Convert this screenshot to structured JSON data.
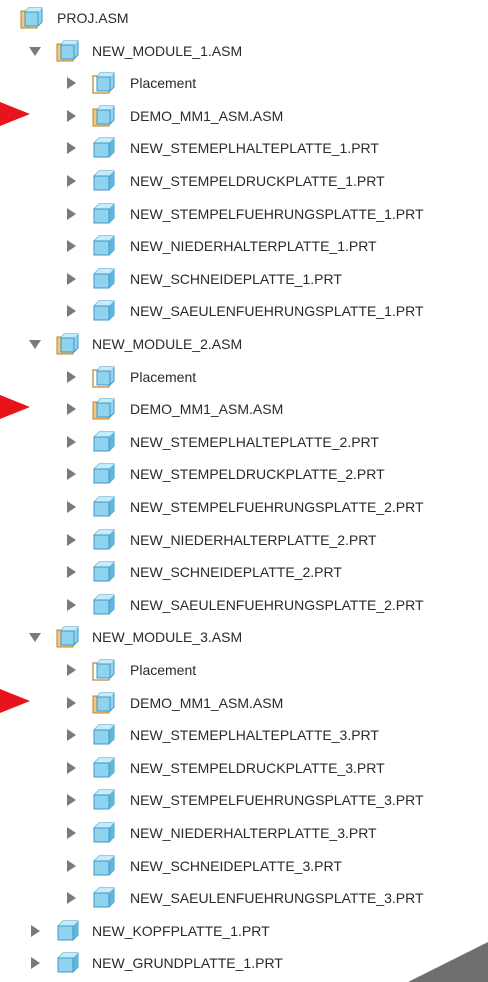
{
  "tree": {
    "root": {
      "label": "PROJ.ASM",
      "icon": "assembly-icon"
    },
    "modules": [
      {
        "label": "NEW_MODULE_1.ASM",
        "icon": "assembly-icon",
        "expanded": true,
        "children": [
          {
            "label": "Placement",
            "icon": "placement-icon"
          },
          {
            "label": "DEMO_MM1_ASM.ASM",
            "icon": "assembly-icon",
            "marked": true
          },
          {
            "label": "NEW_STEMEPLHALTEPLATTE_1.PRT",
            "icon": "part-icon"
          },
          {
            "label": "NEW_STEMPELDRUCKPLATTE_1.PRT",
            "icon": "part-icon"
          },
          {
            "label": "NEW_STEMPELFUEHRUNGSPLATTE_1.PRT",
            "icon": "part-icon"
          },
          {
            "label": "NEW_NIEDERHALTERPLATTE_1.PRT",
            "icon": "part-icon"
          },
          {
            "label": "NEW_SCHNEIDEPLATTE_1.PRT",
            "icon": "part-icon"
          },
          {
            "label": "NEW_SAEULENFUEHRUNGSPLATTE_1.PRT",
            "icon": "part-icon"
          }
        ]
      },
      {
        "label": "NEW_MODULE_2.ASM",
        "icon": "assembly-icon",
        "expanded": true,
        "children": [
          {
            "label": "Placement",
            "icon": "placement-icon"
          },
          {
            "label": "DEMO_MM1_ASM.ASM",
            "icon": "assembly-icon",
            "marked": true
          },
          {
            "label": "NEW_STEMEPLHALTEPLATTE_2.PRT",
            "icon": "part-icon"
          },
          {
            "label": "NEW_STEMPELDRUCKPLATTE_2.PRT",
            "icon": "part-icon"
          },
          {
            "label": "NEW_STEMPELFUEHRUNGSPLATTE_2.PRT",
            "icon": "part-icon"
          },
          {
            "label": "NEW_NIEDERHALTERPLATTE_2.PRT",
            "icon": "part-icon"
          },
          {
            "label": "NEW_SCHNEIDEPLATTE_2.PRT",
            "icon": "part-icon"
          },
          {
            "label": "NEW_SAEULENFUEHRUNGSPLATTE_2.PRT",
            "icon": "part-icon"
          }
        ]
      },
      {
        "label": "NEW_MODULE_3.ASM",
        "icon": "assembly-icon",
        "expanded": true,
        "children": [
          {
            "label": "Placement",
            "icon": "placement-icon"
          },
          {
            "label": "DEMO_MM1_ASM.ASM",
            "icon": "assembly-icon",
            "marked": true
          },
          {
            "label": "NEW_STEMEPLHALTEPLATTE_3.PRT",
            "icon": "part-icon"
          },
          {
            "label": "NEW_STEMPELDRUCKPLATTE_3.PRT",
            "icon": "part-icon"
          },
          {
            "label": "NEW_STEMPELFUEHRUNGSPLATTE_3.PRT",
            "icon": "part-icon"
          },
          {
            "label": "NEW_NIEDERHALTERPLATTE_3.PRT",
            "icon": "part-icon"
          },
          {
            "label": "NEW_SCHNEIDEPLATTE_3.PRT",
            "icon": "part-icon"
          },
          {
            "label": "NEW_SAEULENFUEHRUNGSPLATTE_3.PRT",
            "icon": "part-icon"
          }
        ]
      }
    ],
    "parts": [
      {
        "label": "NEW_KOPFPLATTE_1.PRT",
        "icon": "part-icon"
      },
      {
        "label": "NEW_GRUNDPLATTE_1.PRT",
        "icon": "part-icon"
      }
    ]
  },
  "colors": {
    "text": "#2a2a2a",
    "toggle": "#7a7a7a",
    "marker": "#e8141c",
    "part_fill": "#8fd3ef",
    "part_stroke": "#3f97c4",
    "assembly_fill": "#f4c77c",
    "assembly_stroke": "#b78334",
    "corner": "#6f6f6f"
  }
}
